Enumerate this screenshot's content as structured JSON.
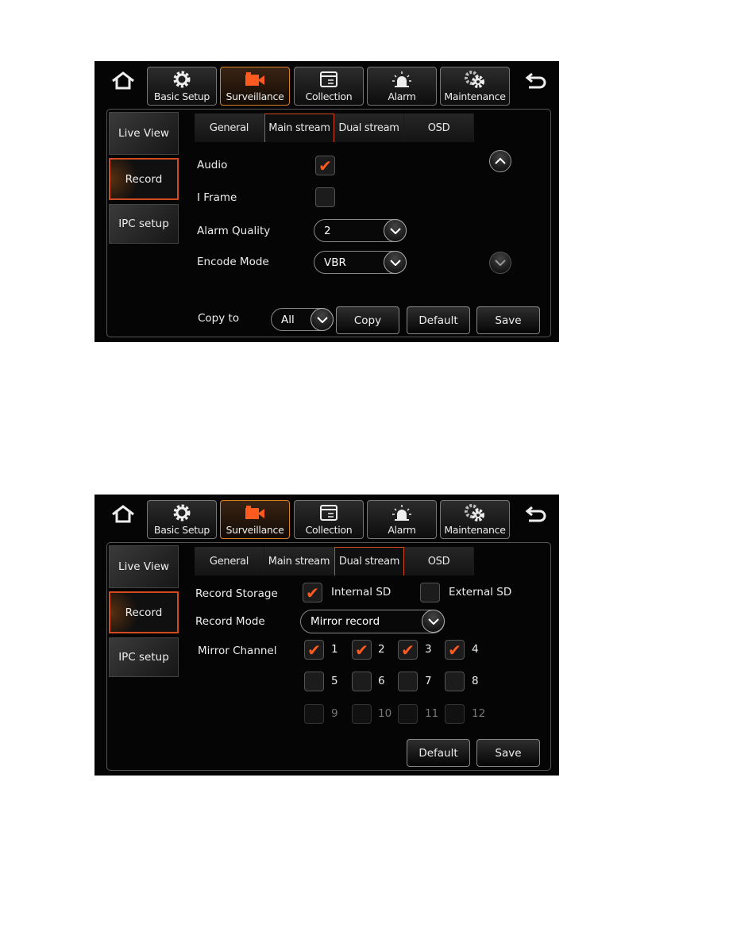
{
  "top_nav": [
    "Basic Setup",
    "Surveillance",
    "Collection",
    "Alarm",
    "Maintenance"
  ],
  "side_nav": [
    "Live View",
    "Record",
    "IPC setup"
  ],
  "sub_tabs": [
    "General",
    "Main stream",
    "Dual stream",
    "OSD"
  ],
  "accent_color": "#d24a1e",
  "icons": {
    "home": "home-icon",
    "back": "back-arrow-icon"
  },
  "screen1": {
    "active_top": "Surveillance",
    "active_side": "Record",
    "active_sub": "Main stream",
    "audio": {
      "label": "Audio",
      "checked": true
    },
    "iframe": {
      "label": "I Frame",
      "checked": false
    },
    "alarm_quality": {
      "label": "Alarm Quality",
      "value": "2"
    },
    "encode_mode": {
      "label": "Encode Mode",
      "value": "VBR"
    },
    "copy_to": {
      "label": "Copy to",
      "value": "All"
    },
    "buttons": {
      "copy": "Copy",
      "default": "Default",
      "save": "Save"
    }
  },
  "screen2": {
    "active_top": "Surveillance",
    "active_side": "Record",
    "active_sub": "Dual stream",
    "record_storage": {
      "label": "Record Storage",
      "internal": "Internal SD",
      "internal_checked": true,
      "external": "External SD",
      "external_checked": false
    },
    "record_mode": {
      "label": "Record Mode",
      "value": "Mirror record"
    },
    "mirror_channel": {
      "label": "Mirror Channel",
      "channels": [
        {
          "n": "1",
          "checked": true,
          "enabled": true
        },
        {
          "n": "2",
          "checked": true,
          "enabled": true
        },
        {
          "n": "3",
          "checked": true,
          "enabled": true
        },
        {
          "n": "4",
          "checked": true,
          "enabled": true
        },
        {
          "n": "5",
          "checked": false,
          "enabled": true
        },
        {
          "n": "6",
          "checked": false,
          "enabled": true
        },
        {
          "n": "7",
          "checked": false,
          "enabled": true
        },
        {
          "n": "8",
          "checked": false,
          "enabled": true
        },
        {
          "n": "9",
          "checked": false,
          "enabled": false
        },
        {
          "n": "10",
          "checked": false,
          "enabled": false
        },
        {
          "n": "11",
          "checked": false,
          "enabled": false
        },
        {
          "n": "12",
          "checked": false,
          "enabled": false
        }
      ]
    },
    "buttons": {
      "default": "Default",
      "save": "Save"
    }
  }
}
